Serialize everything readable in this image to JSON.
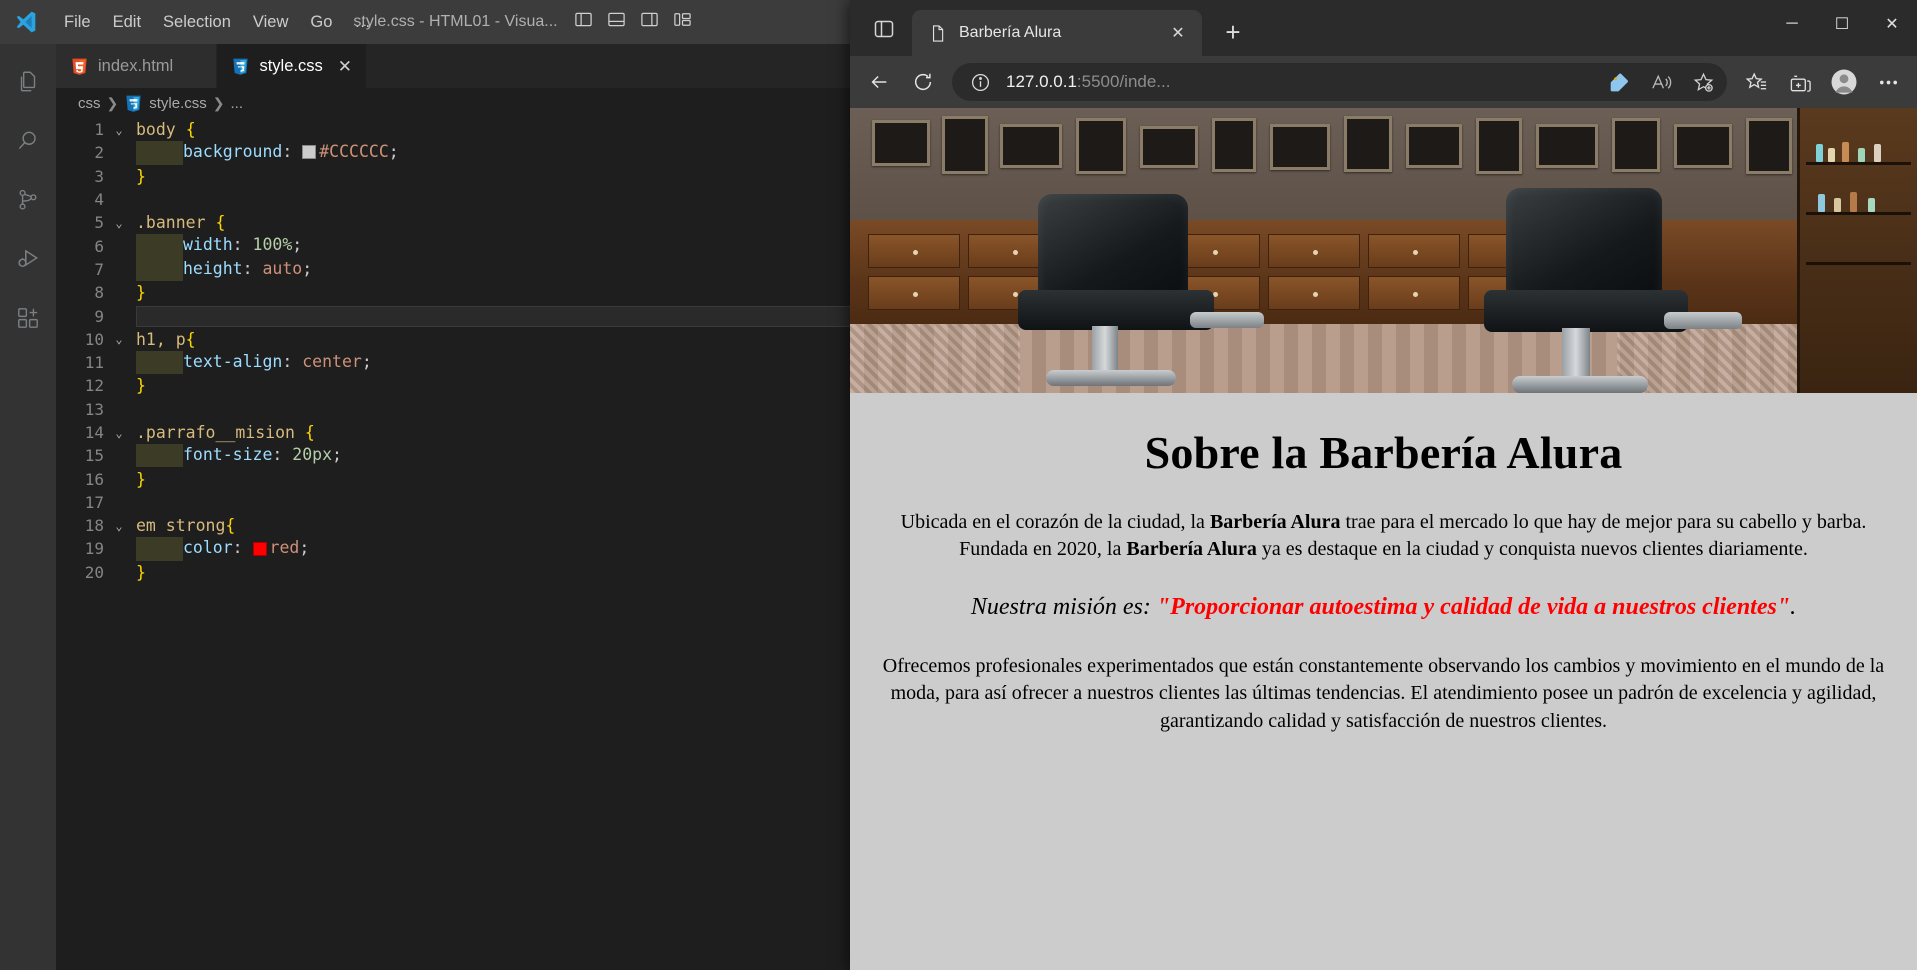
{
  "vscode": {
    "menu": [
      "File",
      "Edit",
      "Selection",
      "View",
      "Go",
      "…"
    ],
    "window_title": "style.css - HTML01 - Visua...",
    "breadcrumb": [
      "css",
      "style.css",
      "..."
    ],
    "tabs": [
      {
        "label": "index.html",
        "icon": "html5-file-icon",
        "active": false
      },
      {
        "label": "style.css",
        "icon": "css3-file-icon",
        "active": true
      }
    ],
    "tab_close_label": "✕",
    "activity_bar": [
      "explorer-icon",
      "search-icon",
      "source-control-icon",
      "run-and-debug-icon",
      "extensions-icon"
    ],
    "window_controls": {
      "minimize": "─",
      "maximize": "☐",
      "close": "✕"
    },
    "code_lines": [
      {
        "n": "1",
        "fold": "⌄",
        "indent": false,
        "blank": false
      },
      {
        "n": "2",
        "fold": "",
        "indent": true,
        "blank": false
      },
      {
        "n": "3",
        "fold": "",
        "indent": false,
        "blank": false
      },
      {
        "n": "4",
        "fold": "",
        "indent": false,
        "blank": true
      },
      {
        "n": "5",
        "fold": "⌄",
        "indent": false,
        "blank": false
      },
      {
        "n": "6",
        "fold": "",
        "indent": true,
        "blank": false
      },
      {
        "n": "7",
        "fold": "",
        "indent": true,
        "blank": false
      },
      {
        "n": "8",
        "fold": "",
        "indent": false,
        "blank": false
      },
      {
        "n": "9",
        "fold": "",
        "indent": false,
        "blank": true
      },
      {
        "n": "10",
        "fold": "⌄",
        "indent": false,
        "blank": false
      },
      {
        "n": "11",
        "fold": "",
        "indent": true,
        "blank": false
      },
      {
        "n": "12",
        "fold": "",
        "indent": false,
        "blank": false
      },
      {
        "n": "13",
        "fold": "",
        "indent": false,
        "blank": true
      },
      {
        "n": "14",
        "fold": "⌄",
        "indent": false,
        "blank": false
      },
      {
        "n": "15",
        "fold": "",
        "indent": true,
        "blank": false
      },
      {
        "n": "16",
        "fold": "",
        "indent": false,
        "blank": false
      },
      {
        "n": "17",
        "fold": "",
        "indent": false,
        "blank": true
      },
      {
        "n": "18",
        "fold": "⌄",
        "indent": false,
        "blank": false
      },
      {
        "n": "19",
        "fold": "",
        "indent": true,
        "blank": false
      },
      {
        "n": "20",
        "fold": "",
        "indent": false,
        "blank": false
      }
    ],
    "code_text": {
      "l1_sel": "body",
      "l1_brace": "{",
      "l2_prop": "background",
      "l2_colon": ": ",
      "l2_val": "#CCCCCC",
      "l2_semi": ";",
      "l2_swatch": "#CCCCCC",
      "l3_brace": "}",
      "l5_sel": ".banner",
      "l5_brace": "{",
      "l6_prop": "width",
      "l6_colon": ": ",
      "l6_val": "100%",
      "l6_semi": ";",
      "l7_prop": "height",
      "l7_colon": ": ",
      "l7_val": "auto",
      "l7_semi": ";",
      "l8_brace": "}",
      "l10_sel": "h1, p",
      "l10_brace": "{",
      "l11_prop": "text-align",
      "l11_colon": ": ",
      "l11_val": "center",
      "l11_semi": ";",
      "l12_brace": "}",
      "l14_sel": ".parrafo__mision",
      "l14_brace": "{",
      "l15_prop": "font-size",
      "l15_colon": ": ",
      "l15_val": "20px",
      "l15_semi": ";",
      "l16_brace": "}",
      "l18_sel": "em strong",
      "l18_brace": "{",
      "l19_prop": "color",
      "l19_colon": ": ",
      "l19_val": "red",
      "l19_semi": ";",
      "l19_swatch": "#ff0000",
      "l20_brace": "}"
    },
    "editor_actions": [
      "split-editor-icon",
      "more-actions-icon"
    ]
  },
  "edge": {
    "tab": {
      "title": "Barbería Alura",
      "favicon": "page-icon",
      "close": "✕"
    },
    "new_tab_label": "+",
    "tab_actions_label": "tab-actions-icon",
    "window_controls": {
      "minimize": "─",
      "maximize": "☐",
      "close": "✕"
    },
    "toolbar": {
      "back": "back-arrow-icon",
      "refresh": "refresh-icon",
      "site_info": "info-icon",
      "url_host": "127.0.0.1",
      "url_path": ":5500/inde...",
      "shopping_icon": "price-tag-icon",
      "read_aloud": "read-aloud-icon",
      "add_favorite": "add-favorite-star-icon",
      "favorites": "favorites-list-icon",
      "collections": "collections-icon",
      "profile": "profile-avatar-icon",
      "settings": "more-settings-icon"
    }
  },
  "page": {
    "banner_alt": "Barbershop interior with two black leather barber chairs",
    "title": "Sobre la Barbería Alura",
    "p1_a": "Ubicada en el corazón de la ciudad, la ",
    "p1_b1": "Barbería Alura",
    "p1_c": " trae para el mercado lo que hay de mejor para su cabello y barba. Fundada en 2020, la ",
    "p1_b2": "Barbería Alura",
    "p1_d": " ya es destaque en la ciudad y conquista nuevos clientes diariamente.",
    "mision_lead": "Nuestra misión es: ",
    "mision_quote": "\"Proporcionar autoestima y calidad de vida a nuestros clientes\"",
    "mision_end": ".",
    "p3": "Ofrecemos profesionales experimentados que están constantemente observando los cambios y movimiento en el mundo de la moda, para así ofrecer a nuestros clientes las últimas tendencias. El atendimiento posee un padrón de excelencia y agilidad, garantizando calidad y satisfacción de nuestros clientes.",
    "background_color": "#CCCCCC",
    "accent_color": "#FF0000"
  }
}
